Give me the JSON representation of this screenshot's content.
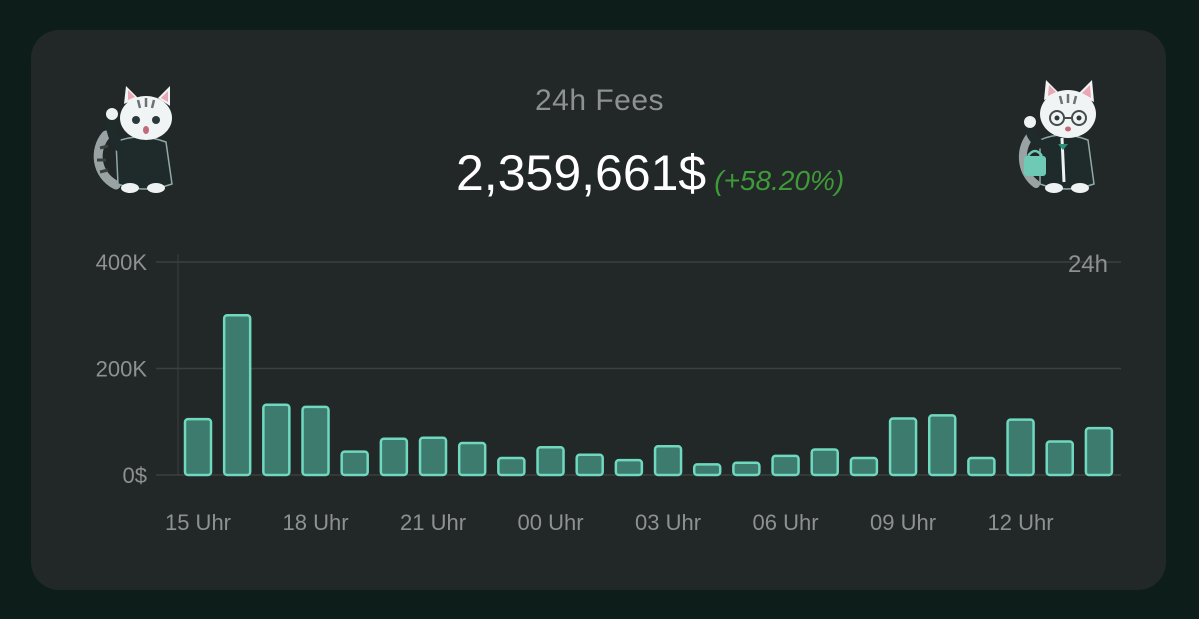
{
  "header": {
    "title": "24h Fees",
    "total_value": "2,359,661$",
    "change": "(+58.20%)"
  },
  "icons": {
    "left": "cat-mascot-hoodie-icon",
    "right": "cat-mascot-glasses-suit-icon"
  },
  "colors": {
    "card_background": "#222727",
    "page_background": "#0d1e1a",
    "bar_fill": "#3d7b6e",
    "bar_stroke": "#6fd8bf",
    "change_color": "#3f9a3a"
  },
  "chart_data": {
    "type": "bar",
    "title": "24h Fees",
    "range_label": "24h",
    "ylim": [
      0,
      400000
    ],
    "y_ticks": [
      {
        "value": 0,
        "label": "0$"
      },
      {
        "value": 200000,
        "label": "200K"
      },
      {
        "value": 400000,
        "label": "400K"
      }
    ],
    "x_tick_labels": [
      "15 Uhr",
      "18 Uhr",
      "21 Uhr",
      "00 Uhr",
      "03 Uhr",
      "06 Uhr",
      "09 Uhr",
      "12 Uhr"
    ],
    "x_tick_every": 3,
    "grid": true,
    "values": [
      105000,
      300000,
      132000,
      128000,
      44000,
      68000,
      70000,
      60000,
      32000,
      52000,
      38000,
      28000,
      54000,
      20000,
      23000,
      36000,
      48000,
      32000,
      106000,
      112000,
      32000,
      104000,
      63000,
      88000
    ]
  }
}
